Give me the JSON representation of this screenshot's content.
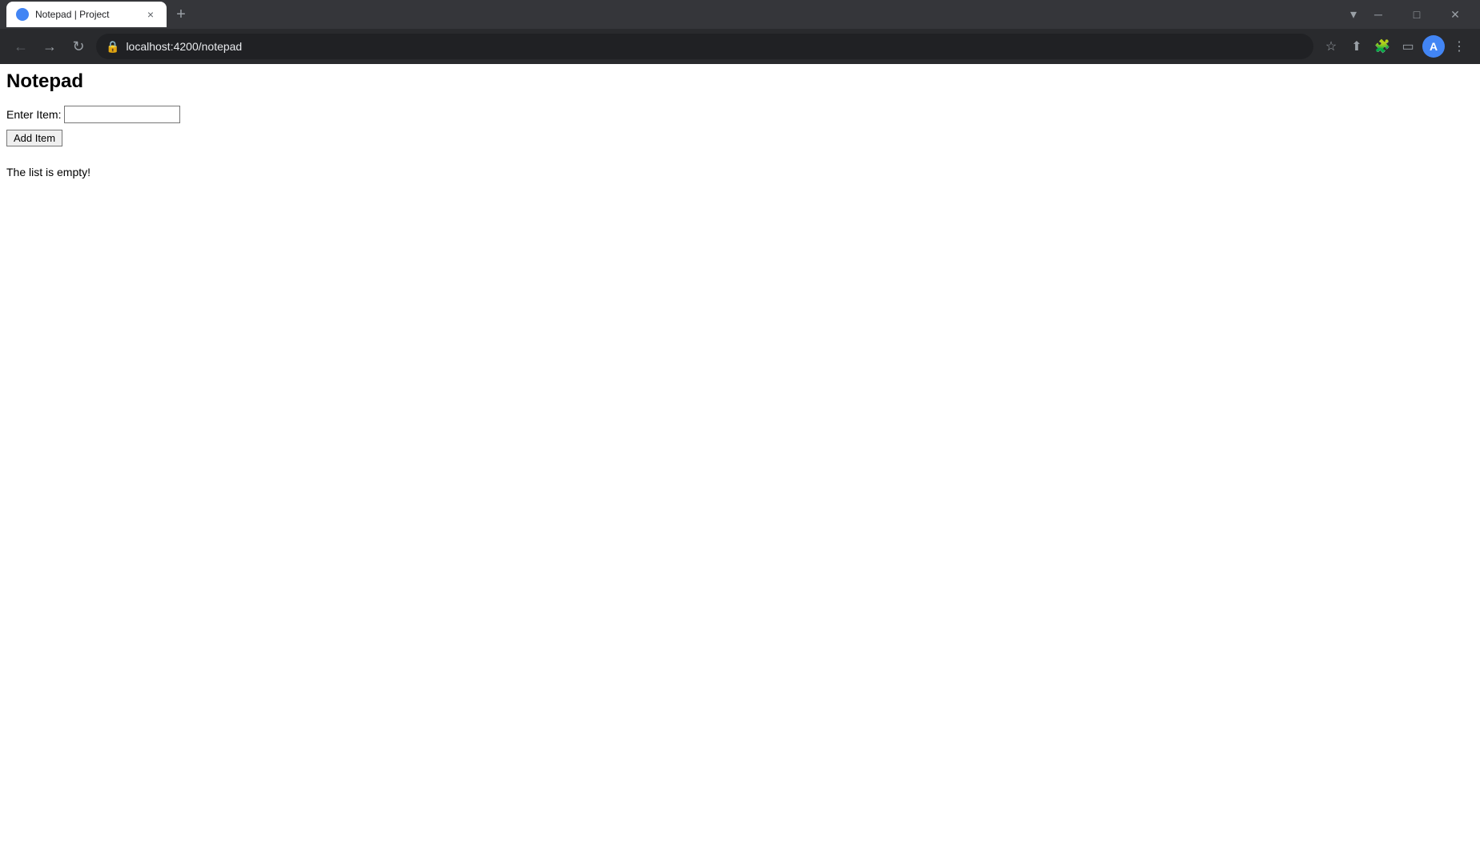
{
  "browser": {
    "tab": {
      "favicon_color": "#4285f4",
      "title": "Notepad | Project",
      "close_label": "×"
    },
    "new_tab_label": "+",
    "tab_dropdown_label": "▾",
    "window_controls": {
      "minimize": "─",
      "maximize": "□",
      "close": "✕"
    },
    "address_bar": {
      "url": "localhost:4200/notepad",
      "lock_icon": "🔒"
    },
    "nav": {
      "back": "←",
      "forward": "→",
      "reload": "↻"
    }
  },
  "page": {
    "title": "Notepad",
    "form": {
      "label": "Enter Item:",
      "input_placeholder": "",
      "input_value": "",
      "button_label": "Add Item"
    },
    "empty_message": "The list is empty!"
  }
}
